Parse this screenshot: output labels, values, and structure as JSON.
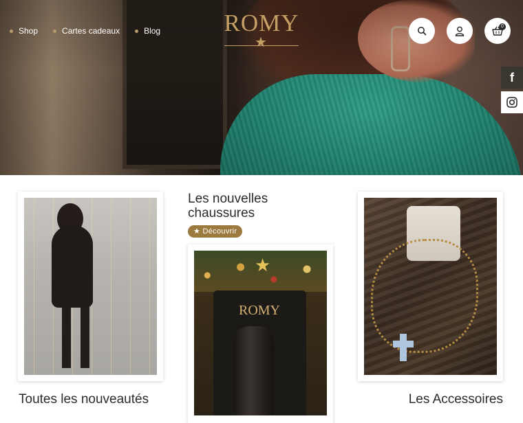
{
  "header": {
    "nav": [
      {
        "label": "Shop"
      },
      {
        "label": "Cartes cadeaux"
      },
      {
        "label": "Blog"
      }
    ],
    "logo": {
      "text": "ROMY"
    },
    "cart_count": "0",
    "icons": [
      "search-icon",
      "user-icon",
      "basket-icon"
    ]
  },
  "social": {
    "facebook_glyph": "f",
    "icons": [
      "facebook-icon",
      "instagram-icon"
    ]
  },
  "sections": {
    "left": {
      "title": "Toutes les nouveautés"
    },
    "middle": {
      "title_line1": "Les nouvelles",
      "title_line2": "chaussures",
      "cta": "★ Découvrir",
      "sign": "ROMY"
    },
    "right": {
      "title": "Les Accessoires"
    }
  },
  "colors": {
    "accent_gold": "#c5a064",
    "button_bronze": "#9c7a3f",
    "text_dark": "#2b2b2b"
  }
}
